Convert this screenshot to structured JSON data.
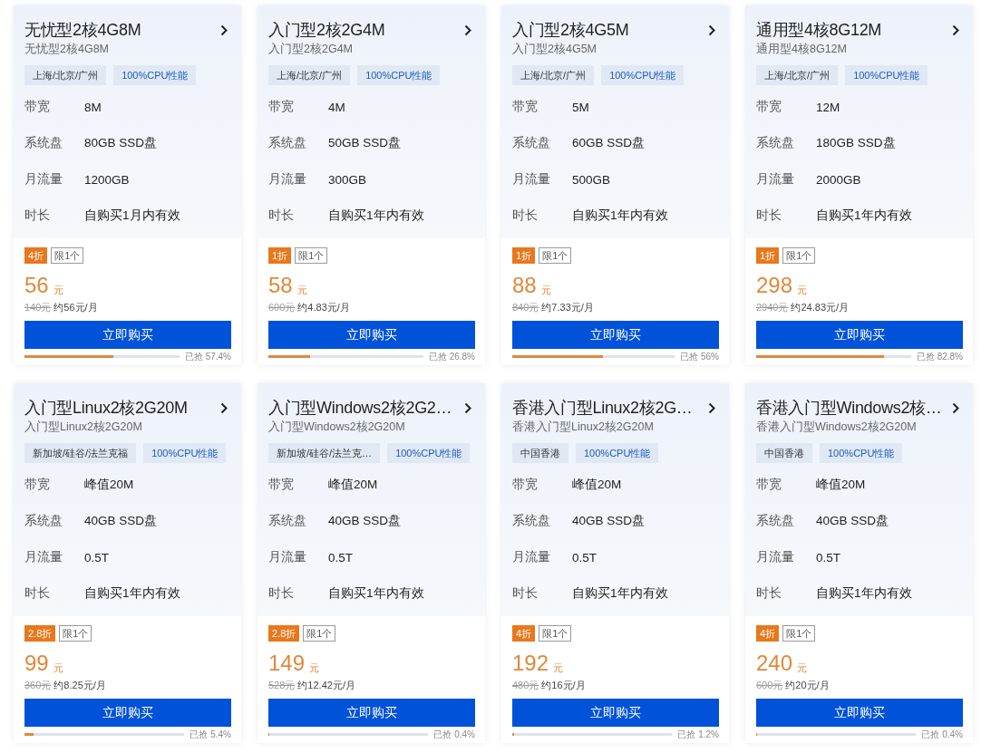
{
  "products": [
    {
      "title": "无忧型2核4G8M",
      "subtitle": "无忧型2核4G8M",
      "tags": [
        {
          "kind": "region",
          "label": "上海/北京/广州"
        },
        {
          "kind": "feature",
          "label": "100%CPU性能"
        }
      ],
      "specs": [
        {
          "label": "带宽",
          "value": "8M"
        },
        {
          "label": "系统盘",
          "value": "80GB SSD盘"
        },
        {
          "label": "月流量",
          "value": "1200GB"
        },
        {
          "label": "时长",
          "value": "自购买1月内有效"
        }
      ],
      "discount": "4折",
      "limit": "限1个",
      "price": "56",
      "currency": "元",
      "original_price": "140元",
      "monthly": "约56元/月",
      "button": "立即购买",
      "sold": {
        "level": 0.574,
        "reading": "已抢 57.4%"
      }
    },
    {
      "title": "入门型2核2G4M",
      "subtitle": "入门型2核2G4M",
      "tags": [
        {
          "kind": "region",
          "label": "上海/北京/广州"
        },
        {
          "kind": "feature",
          "label": "100%CPU性能"
        }
      ],
      "specs": [
        {
          "label": "带宽",
          "value": "4M"
        },
        {
          "label": "系统盘",
          "value": "50GB SSD盘"
        },
        {
          "label": "月流量",
          "value": "300GB"
        },
        {
          "label": "时长",
          "value": "自购买1年内有效"
        }
      ],
      "discount": "1折",
      "limit": "限1个",
      "price": "58",
      "currency": "元",
      "original_price": "600元",
      "monthly": "约4.83元/月",
      "button": "立即购买",
      "sold": {
        "level": 0.268,
        "reading": "已抢 26.8%"
      }
    },
    {
      "title": "入门型2核4G5M",
      "subtitle": "入门型2核4G5M",
      "tags": [
        {
          "kind": "region",
          "label": "上海/北京/广州"
        },
        {
          "kind": "feature",
          "label": "100%CPU性能"
        }
      ],
      "specs": [
        {
          "label": "带宽",
          "value": "5M"
        },
        {
          "label": "系统盘",
          "value": "60GB SSD盘"
        },
        {
          "label": "月流量",
          "value": "500GB"
        },
        {
          "label": "时长",
          "value": "自购买1年内有效"
        }
      ],
      "discount": "1折",
      "limit": "限1个",
      "price": "88",
      "currency": "元",
      "original_price": "840元",
      "monthly": "约7.33元/月",
      "button": "立即购买",
      "sold": {
        "level": 0.56,
        "reading": "已抢 56%"
      }
    },
    {
      "title": "通用型4核8G12M",
      "subtitle": "通用型4核8G12M",
      "tags": [
        {
          "kind": "region",
          "label": "上海/北京/广州"
        },
        {
          "kind": "feature",
          "label": "100%CPU性能"
        }
      ],
      "specs": [
        {
          "label": "带宽",
          "value": "12M"
        },
        {
          "label": "系统盘",
          "value": "180GB SSD盘"
        },
        {
          "label": "月流量",
          "value": "2000GB"
        },
        {
          "label": "时长",
          "value": "自购买1年内有效"
        }
      ],
      "discount": "1折",
      "limit": "限1个",
      "price": "298",
      "currency": "元",
      "original_price": "2940元",
      "monthly": "约24.83元/月",
      "button": "立即购买",
      "sold": {
        "level": 0.828,
        "reading": "已抢 82.8%"
      }
    },
    {
      "title": "入门型Linux2核2G20M",
      "subtitle": "入门型Linux2核2G20M",
      "tags": [
        {
          "kind": "region",
          "label": "新加坡/硅谷/法兰克福"
        },
        {
          "kind": "feature",
          "label": "100%CPU性能"
        }
      ],
      "specs": [
        {
          "label": "带宽",
          "value": "峰值20M"
        },
        {
          "label": "系统盘",
          "value": "40GB SSD盘"
        },
        {
          "label": "月流量",
          "value": "0.5T"
        },
        {
          "label": "时长",
          "value": "自购买1年内有效"
        }
      ],
      "discount": "2.8折",
      "limit": "限1个",
      "price": "99",
      "currency": "元",
      "original_price": "360元",
      "monthly": "约8.25元/月",
      "button": "立即购买",
      "sold": {
        "level": 0.054,
        "reading": "已抢 5.4%"
      }
    },
    {
      "title": "入门型Windows2核2G2…",
      "subtitle": "入门型Windows2核2G20M",
      "tags": [
        {
          "kind": "region",
          "label": "新加坡/硅谷/法兰克…"
        },
        {
          "kind": "feature",
          "label": "100%CPU性能"
        }
      ],
      "specs": [
        {
          "label": "带宽",
          "value": "峰值20M"
        },
        {
          "label": "系统盘",
          "value": "40GB SSD盘"
        },
        {
          "label": "月流量",
          "value": "0.5T"
        },
        {
          "label": "时长",
          "value": "自购买1年内有效"
        }
      ],
      "discount": "2.8折",
      "limit": "限1个",
      "price": "149",
      "currency": "元",
      "original_price": "528元",
      "monthly": "约12.42元/月",
      "button": "立即购买",
      "sold": {
        "level": 0.004,
        "reading": "已抢 0.4%"
      }
    },
    {
      "title": "香港入门型Linux2核2G…",
      "subtitle": "香港入门型Linux2核2G20M",
      "tags": [
        {
          "kind": "region",
          "label": "中国香港"
        },
        {
          "kind": "feature",
          "label": "100%CPU性能"
        }
      ],
      "specs": [
        {
          "label": "带宽",
          "value": "峰值20M"
        },
        {
          "label": "系统盘",
          "value": "40GB SSD盘"
        },
        {
          "label": "月流量",
          "value": "0.5T"
        },
        {
          "label": "时长",
          "value": "自购买1年内有效"
        }
      ],
      "discount": "4折",
      "limit": "限1个",
      "price": "192",
      "currency": "元",
      "original_price": "480元",
      "monthly": "约16元/月",
      "button": "立即购买",
      "sold": {
        "level": 0.012,
        "reading": "已抢 1.2%"
      }
    },
    {
      "title": "香港入门型Windows2核…",
      "subtitle": "香港入门型Windows2核2G20M",
      "tags": [
        {
          "kind": "region",
          "label": "中国香港"
        },
        {
          "kind": "feature",
          "label": "100%CPU性能"
        }
      ],
      "specs": [
        {
          "label": "带宽",
          "value": "峰值20M"
        },
        {
          "label": "系统盘",
          "value": "40GB SSD盘"
        },
        {
          "label": "月流量",
          "value": "0.5T"
        },
        {
          "label": "时长",
          "value": "自购买1年内有效"
        }
      ],
      "discount": "4折",
      "limit": "限1个",
      "price": "240",
      "currency": "元",
      "original_price": "600元",
      "monthly": "约20元/月",
      "button": "立即购买",
      "sold": {
        "level": 0.004,
        "reading": "已抢 0.4%"
      }
    }
  ]
}
